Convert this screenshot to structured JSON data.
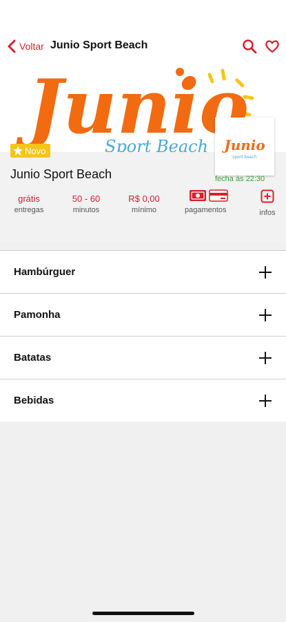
{
  "nav": {
    "back_label": "Voltar",
    "title": "Junio Sport Beach",
    "icons": [
      "chevron-left-icon",
      "search-icon",
      "heart-icon"
    ]
  },
  "banner": {
    "logo_text": "Junio",
    "logo_subtext": "Sport Beach",
    "thumb_text": "Junio",
    "thumb_subtext": "sport beach"
  },
  "store": {
    "badge": "Novo",
    "name": "Junio Sport Beach",
    "closing": "fecha às 22:30"
  },
  "stats": [
    {
      "value": "grátis",
      "label": "entregas"
    },
    {
      "value": "50 - 60",
      "label": "minutos"
    },
    {
      "value": "R$ 0,00",
      "label": "mínimo"
    }
  ],
  "payments": {
    "label": "pagamentos"
  },
  "infos": {
    "label": "infos"
  },
  "categories": [
    {
      "label": "Hambúrguer"
    },
    {
      "label": "Pamonha"
    },
    {
      "label": "Batatas"
    },
    {
      "label": "Bebidas"
    }
  ],
  "colors": {
    "accent": "#d81f2e",
    "badge": "#f5c518",
    "open_green": "#3aa335",
    "logo_orange": "#f26b11",
    "logo_blue": "#4aa7d8"
  }
}
